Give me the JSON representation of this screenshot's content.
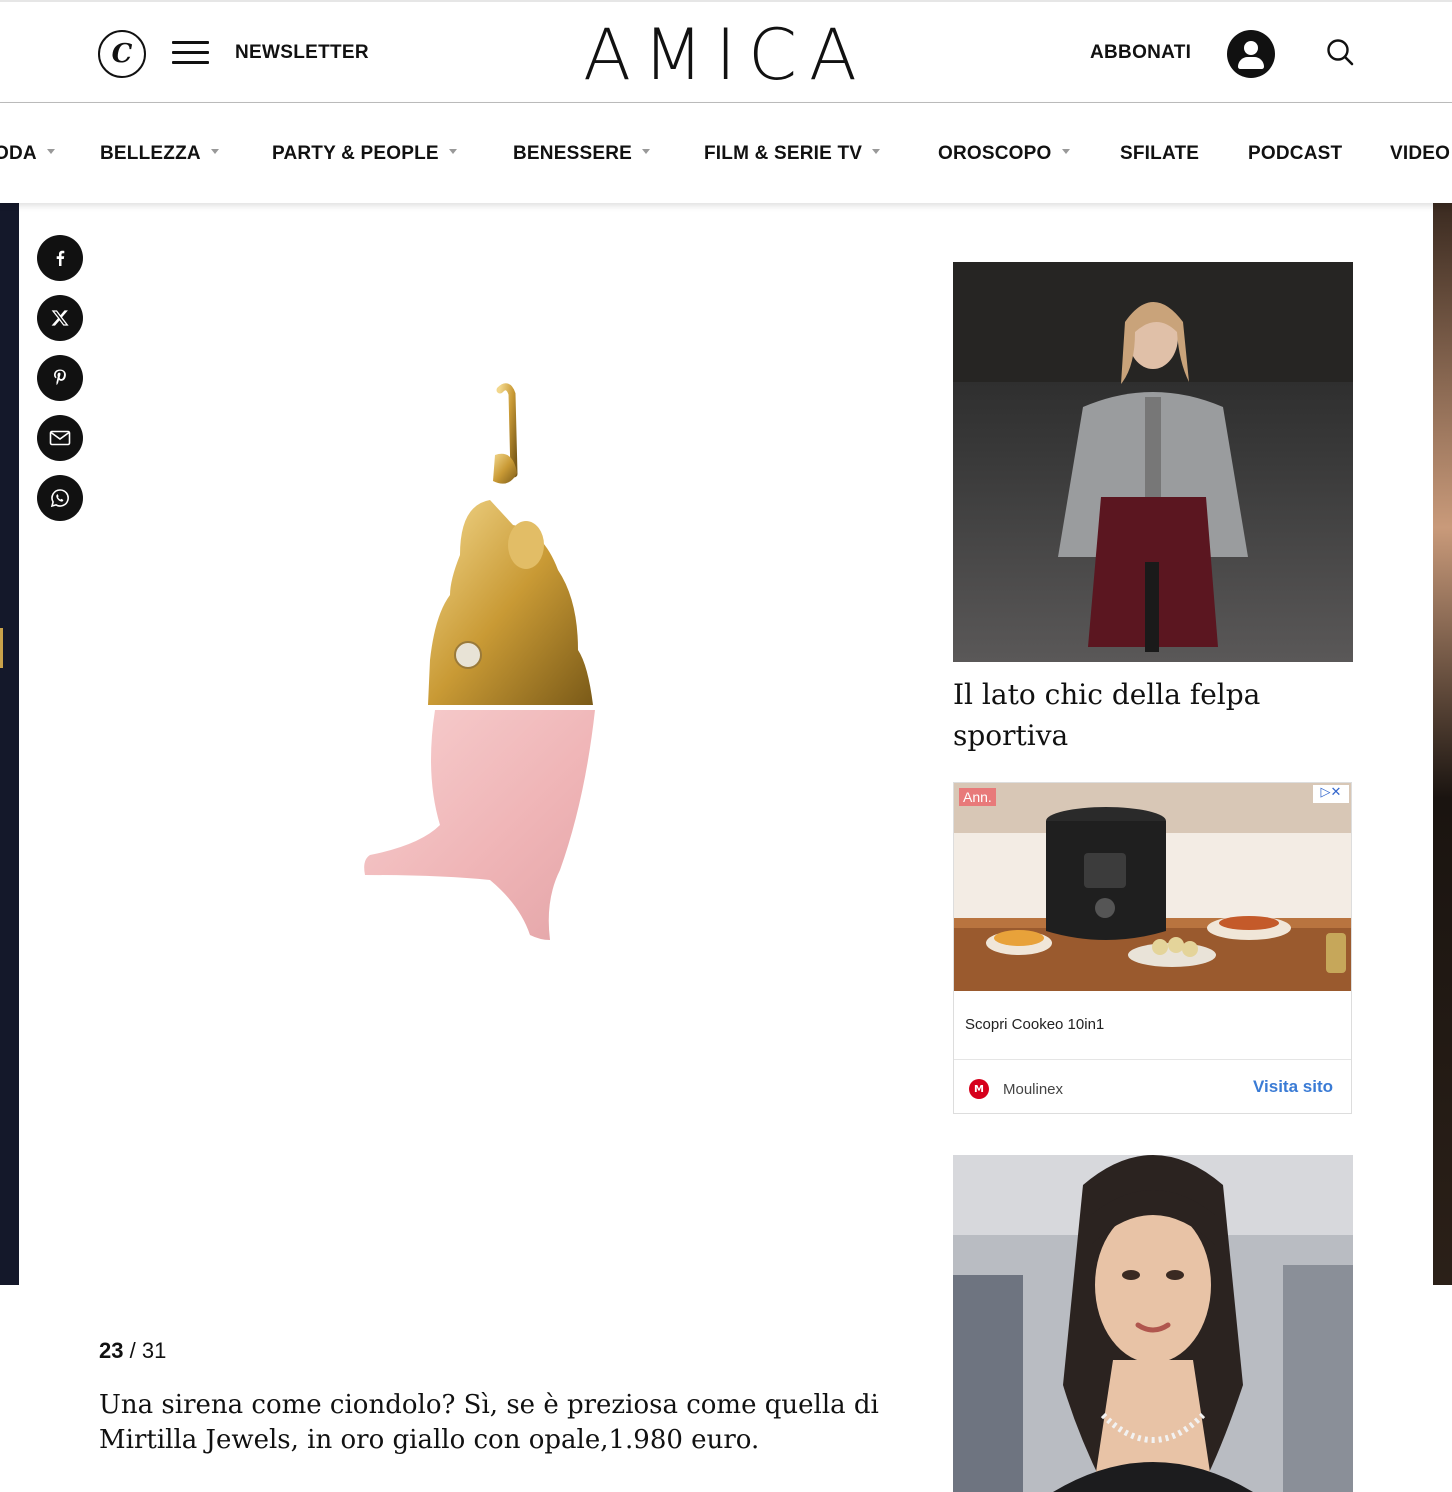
{
  "header": {
    "newsletter_label": "NEWSLETTER",
    "brand": "AMICA",
    "subscribe_label": "ABBONATI",
    "c_logo_glyph": "C"
  },
  "nav": {
    "items": [
      {
        "label": "ODA",
        "has_dropdown": true
      },
      {
        "label": "BELLEZZA",
        "has_dropdown": true
      },
      {
        "label": "PARTY & PEOPLE",
        "has_dropdown": true
      },
      {
        "label": "BENESSERE",
        "has_dropdown": true
      },
      {
        "label": "FILM & SERIE TV",
        "has_dropdown": true
      },
      {
        "label": "OROSCOPO",
        "has_dropdown": true
      },
      {
        "label": "SFILATE",
        "has_dropdown": false
      },
      {
        "label": "PODCAST",
        "has_dropdown": false
      },
      {
        "label": "VIDEO",
        "has_dropdown": false
      }
    ]
  },
  "share": {
    "icons": [
      "facebook-icon",
      "x-icon",
      "pinterest-icon",
      "email-icon",
      "whatsapp-icon"
    ]
  },
  "gallery": {
    "current": "23",
    "separator": "/",
    "total": "31",
    "caption": "Una sirena come ciondolo? Sì, se è preziosa come quella di Mirtilla Jewels, in oro giallo con opale,1.980 euro."
  },
  "sidebar": {
    "card1": {
      "title": "Il lato chic della felpa sportiva"
    },
    "ad": {
      "badge": "Ann.",
      "text": "Scopri Cookeo 10in1",
      "advertiser": "Moulinex",
      "cta": "Visita sito"
    }
  },
  "colors": {
    "text": "#111111",
    "ad_cta": "#3a7bd5",
    "ad_badge": "#e87a7a",
    "moulinex_red": "#d6001c"
  }
}
